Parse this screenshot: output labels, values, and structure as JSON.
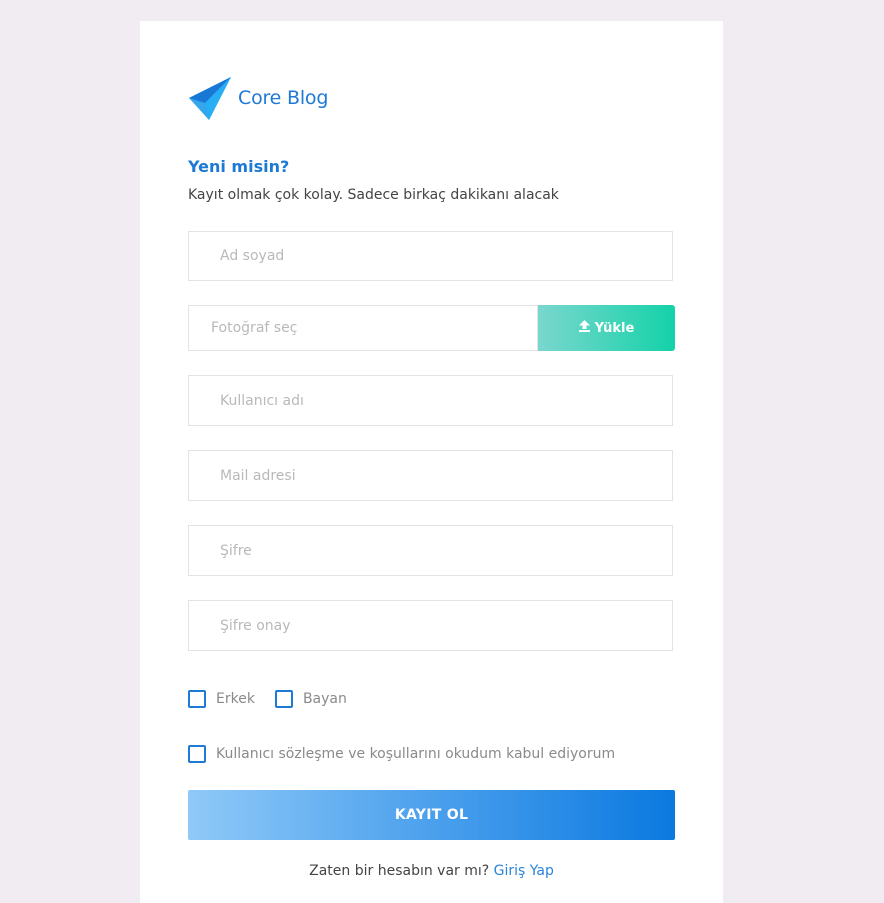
{
  "brand": {
    "name": "Core Blog",
    "icon": "paper-plane-icon",
    "color": "#1f7ad6"
  },
  "intro": {
    "heading": "Yeni misin?",
    "subtext": "Kayıt olmak çok kolay. Sadece birkaç dakikanı alacak"
  },
  "form": {
    "full_name_placeholder": "Ad soyad",
    "photo_placeholder": "Fotoğraf seç",
    "upload_label": "Yükle",
    "upload_icon": "upload-icon",
    "username_placeholder": "Kullanıcı adı",
    "email_placeholder": "Mail adresi",
    "password_placeholder": "Şifre",
    "password_confirm_placeholder": "Şifre onay",
    "gender": {
      "male_label": "Erkek",
      "female_label": "Bayan"
    },
    "terms_label": "Kullanıcı sözleşme ve koşullarını okudum kabul ediyorum",
    "submit_label": "KAYIT OL"
  },
  "footer": {
    "prompt": "Zaten bir hesabın var mı?",
    "login_link": "Giriş Yap"
  },
  "colors": {
    "accent": "#1f7ad6",
    "upload_gradient": [
      "#7ad7cd",
      "#14d2a9"
    ],
    "submit_gradient": [
      "#8fc9f8",
      "#0a79e0"
    ],
    "background": "#f1ecf2"
  }
}
